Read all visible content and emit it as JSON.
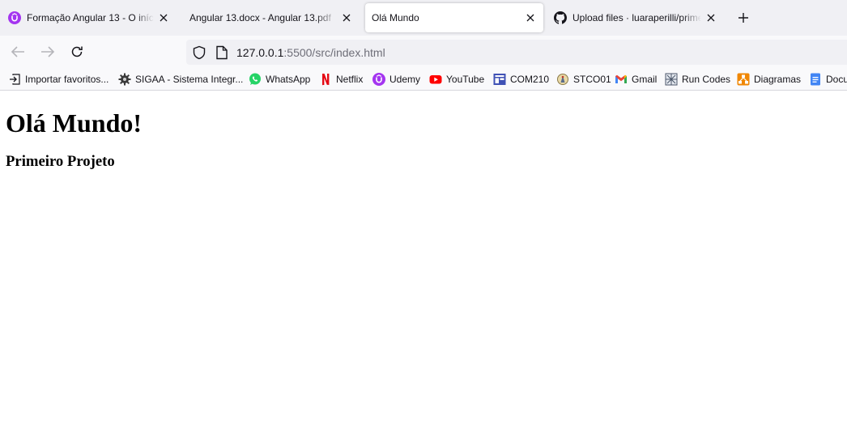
{
  "tabs": [
    {
      "label": "Formação Angular 13 - O início",
      "icon": "udemy-icon",
      "active": false
    },
    {
      "label": "Angular 13.docx - Angular 13.pdf",
      "icon": "none",
      "active": false
    },
    {
      "label": "Olá Mundo",
      "icon": "none",
      "active": true
    },
    {
      "label": "Upload files · luaraperilli/primeiro",
      "icon": "github-icon",
      "active": false
    }
  ],
  "address": {
    "host": "127.0.0.1",
    "rest": ":5500/src/index.html"
  },
  "bookmarks": [
    {
      "label": "Importar favoritos...",
      "icon": "import-icon"
    },
    {
      "label": "SIGAA - Sistema Integr...",
      "icon": "sigaa-icon"
    },
    {
      "label": "WhatsApp",
      "icon": "whatsapp-icon"
    },
    {
      "label": "Netflix",
      "icon": "netflix-icon"
    },
    {
      "label": "Udemy",
      "icon": "udemy-icon"
    },
    {
      "label": "YouTube",
      "icon": "youtube-icon"
    },
    {
      "label": "COM210",
      "icon": "com210-icon"
    },
    {
      "label": "STCO01",
      "icon": "stco01-icon"
    },
    {
      "label": "Gmail",
      "icon": "gmail-icon"
    },
    {
      "label": "Run Codes",
      "icon": "runcodes-icon"
    },
    {
      "label": "Diagramas",
      "icon": "diagrams-icon"
    },
    {
      "label": "Docu",
      "icon": "docs-icon"
    }
  ],
  "page": {
    "heading": "Olá Mundo!",
    "subheading": "Primeiro Projeto"
  },
  "colors": {
    "tabstrip_bg": "#f0f0f4",
    "toolbar_bg": "#f9f9fb",
    "udemy_purple": "#a435f0",
    "whatsapp_green": "#25d366",
    "netflix_red": "#e50914",
    "youtube_red": "#ff0000",
    "gmail_red": "#ea4335",
    "docs_blue": "#4285f4",
    "diagrams_orange": "#f08705",
    "com210_blue": "#3f51b5"
  }
}
